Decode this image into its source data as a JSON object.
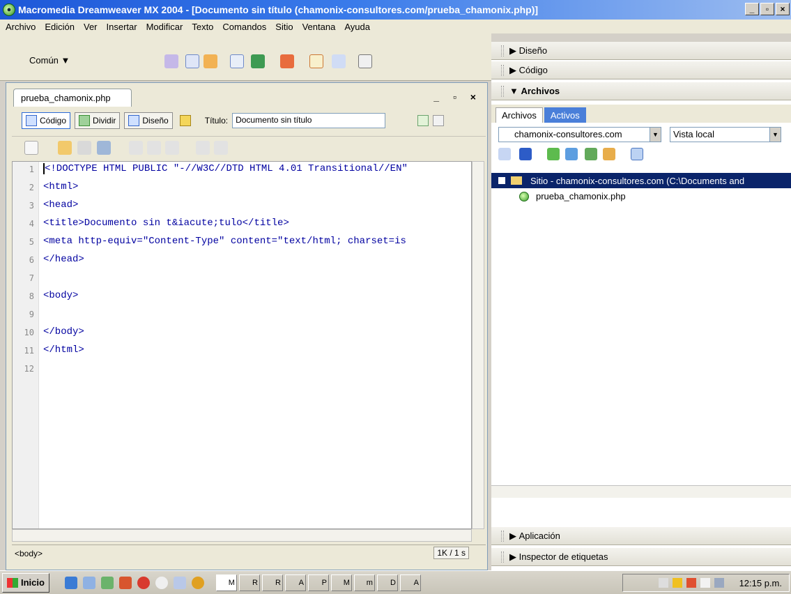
{
  "window": {
    "title": "Macromedia Dreamweaver MX 2004 - [Documento sin título (chamonix-consultores.com/prueba_chamonix.php)]",
    "minimize": "_",
    "maximize": "▫",
    "close": "×"
  },
  "menu": [
    "Archivo",
    "Edición",
    "Ver",
    "Insertar",
    "Modificar",
    "Texto",
    "Comandos",
    "Sitio",
    "Ventana",
    "Ayuda"
  ],
  "insertbar": {
    "category": "Común ▼"
  },
  "document": {
    "tab": "prueba_chamonix.php",
    "win_controls": "_ ▫ ×",
    "views": {
      "code": "Código",
      "split": "Dividir",
      "design": "Diseño"
    },
    "title_label": "Título:",
    "title_value": "Documento sin título",
    "line_numbers": [
      "1",
      "2",
      "3",
      "4",
      "5",
      "6",
      "7",
      "8",
      "9",
      "10",
      "11",
      "12"
    ],
    "lines": [
      "<!DOCTYPE HTML PUBLIC \"-//W3C//DTD HTML 4.01 Transitional//EN\"",
      "<html>",
      "<head>",
      "<title>Documento sin t&iacute;tulo</title>",
      "<meta http-equiv=\"Content-Type\" content=\"text/html; charset=is",
      "</head>",
      "",
      "<body>",
      "",
      "</body>",
      "</html>",
      ""
    ],
    "status_tag": "<body>",
    "status_size": "1K / 1 s"
  },
  "panels": {
    "design": "Diseño",
    "code": "Código",
    "files": "Archivos",
    "app": "Aplicación",
    "inspector": "Inspector de etiquetas"
  },
  "files": {
    "tab_files": "Archivos",
    "tab_active": "Activos",
    "site_select": "chamonix-consultores.com",
    "view_select": "Vista local",
    "site_root": "Sitio - chamonix-consultores.com (C:\\Documents and",
    "file": "prueba_chamonix.php"
  },
  "taskbar": {
    "start": "Inicio",
    "tasks": [
      "M",
      "R",
      "R",
      "A",
      "P",
      "M",
      "m",
      "D",
      "A"
    ],
    "clock": "12:15 p.m."
  },
  "colors": {
    "title_blue": "#1d57d8",
    "selected_row": "#0a246a",
    "code_blue": "#0000a0"
  }
}
